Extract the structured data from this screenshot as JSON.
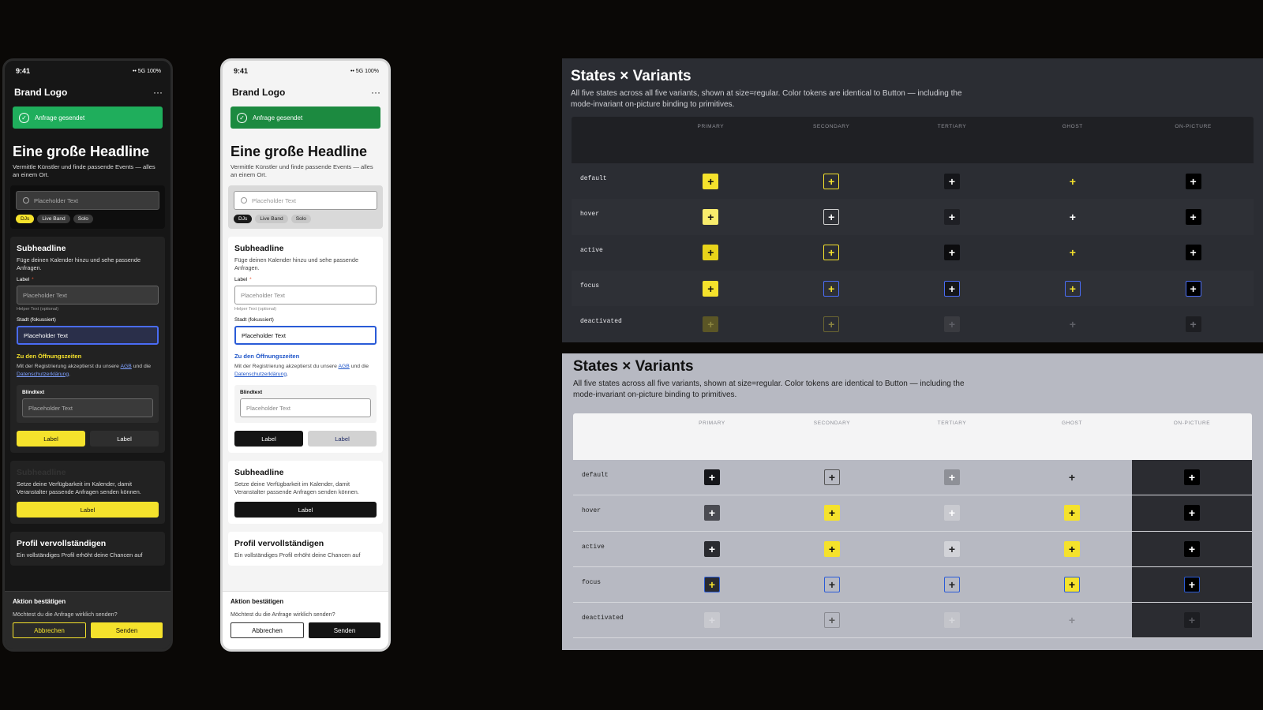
{
  "phones": [
    {
      "theme": "dark",
      "status": {
        "time": "9:41",
        "right": "•• 5G 100%"
      },
      "brand": "Brand Logo",
      "more": "···",
      "toast": "Anfrage gesendet",
      "headline": "Eine große Headline",
      "lead": "Vermittle Künstler und finde passende Events — alles an einem Ort.",
      "search_placeholder": "Placeholder Text",
      "chips": [
        "DJs",
        "Live Band",
        "Solo"
      ],
      "card1": {
        "title": "Subheadline",
        "text": "Füge deinen Kalender hinzu und sehe passende Anfragen.",
        "label": "Label",
        "req": "*",
        "field_placeholder": "Placeholder Text",
        "helper": "Helper Text (optional)",
        "focus_label": "Stadt (fokussiert)",
        "focus_value": "Placeholder Text",
        "link": "Zu den Öffnungszeiten",
        "legal_pre": "Mit der Registrierung akzeptierst du unsere",
        "legal_agb": "AGB",
        "legal_mid": "und die",
        "legal_ds": "Datenschutzerklärung",
        "legal_end": ".",
        "inner_label": "Blindtext",
        "inner_placeholder": "Placeholder Text",
        "btn_primary": "Label",
        "btn_secondary": "Label"
      },
      "card2": {
        "title": "Subheadline",
        "text": "Setze deine Verfügbarkeit im Kalender, damit Veranstalter passende Anfragen senden können.",
        "button": "Label"
      },
      "card3": {
        "title": "Profil vervollständigen",
        "text": "Ein vollständiges Profil erhöht deine Chancen auf"
      },
      "sheet": {
        "title": "Aktion bestätigen",
        "question": "Möchtest du die Anfrage wirklich senden?",
        "cancel": "Abbrechen",
        "send": "Senden"
      }
    },
    {
      "theme": "light",
      "status": {
        "time": "9:41",
        "right": "•• 5G 100%"
      },
      "brand": "Brand Logo",
      "more": "···",
      "toast": "Anfrage gesendet",
      "headline": "Eine große Headline",
      "lead": "Vermittle Künstler und finde passende Events — alles an einem Ort.",
      "search_placeholder": "Placeholder Text",
      "chips": [
        "DJs",
        "Live Band",
        "Solo"
      ],
      "card1": {
        "title": "Subheadline",
        "text": "Füge deinen Kalender hinzu und sehe passende Anfragen.",
        "label": "Label",
        "req": "*",
        "field_placeholder": "Placeholder Text",
        "helper": "Helper Text (optional)",
        "focus_label": "Stadt (fokussiert)",
        "focus_value": "Placeholder Text",
        "link": "Zu den Öffnungszeiten",
        "legal_pre": "Mit der Registrierung akzeptierst du unsere",
        "legal_agb": "AGB",
        "legal_mid": "und die",
        "legal_ds": "Datenschutzerklärung",
        "legal_end": ".",
        "inner_label": "Blindtext",
        "inner_placeholder": "Placeholder Text",
        "btn_primary": "Label",
        "btn_secondary": "Label"
      },
      "card2": {
        "title": "Subheadline",
        "text": "Setze deine Verfügbarkeit im Kalender, damit Veranstalter passende Anfragen senden können.",
        "button": "Label"
      },
      "card3": {
        "title": "Profil vervollständigen",
        "text": "Ein vollständiges Profil erhöht deine Chancen auf"
      },
      "sheet": {
        "title": "Aktion bestätigen",
        "question": "Möchtest du die Anfrage wirklich senden?",
        "cancel": "Abbrechen",
        "send": "Senden"
      }
    }
  ],
  "panels": [
    {
      "mode": "dark",
      "title": "States × Variants",
      "description": "All five states across all five variants, shown at size=regular. Color tokens are identical to Button — including the mode-invariant on-picture binding to primitives.",
      "columns": [
        "PRIMARY",
        "SECONDARY",
        "TERTIARY",
        "GHOST",
        "ON-PICTURE"
      ],
      "rows": [
        {
          "state": "default",
          "cells": [
            {
              "bg": "#f5e22c",
              "fg": "#111111",
              "border": "none"
            },
            {
              "bg": "transparent",
              "fg": "#f5e22c",
              "border": "#f5e22c"
            },
            {
              "bg": "#15161a",
              "fg": "#ffffff",
              "border": "none"
            },
            {
              "bg": "transparent",
              "fg": "#f5e22c",
              "border": "none"
            },
            {
              "bg": "#000000",
              "fg": "#ffffff",
              "border": "none"
            }
          ]
        },
        {
          "state": "hover",
          "cells": [
            {
              "bg": "#f8ec6c",
              "fg": "#111111",
              "border": "none"
            },
            {
              "bg": "transparent",
              "fg": "#ffffff",
              "border": "#cfcfcf"
            },
            {
              "bg": "#1e1f24",
              "fg": "#ffffff",
              "border": "none"
            },
            {
              "bg": "transparent",
              "fg": "#ffffff",
              "border": "none"
            },
            {
              "bg": "#000000",
              "fg": "#ffffff",
              "border": "none"
            }
          ]
        },
        {
          "state": "active",
          "cells": [
            {
              "bg": "#e8d31a",
              "fg": "#111111",
              "border": "none"
            },
            {
              "bg": "transparent",
              "fg": "#f5e22c",
              "border": "#f5e22c"
            },
            {
              "bg": "#0c0c0e",
              "fg": "#ffffff",
              "border": "none"
            },
            {
              "bg": "transparent",
              "fg": "#f5e22c",
              "border": "none"
            },
            {
              "bg": "#000000",
              "fg": "#ffffff",
              "border": "none"
            }
          ]
        },
        {
          "state": "focus",
          "cells": [
            {
              "bg": "#f5e22c",
              "fg": "#111111",
              "border": "none"
            },
            {
              "bg": "transparent",
              "fg": "#f5e22c",
              "border": "#4a6cf5"
            },
            {
              "bg": "#15161a",
              "fg": "#ffffff",
              "border": "#4a6cf5"
            },
            {
              "bg": "transparent",
              "fg": "#f5e22c",
              "border": "#4a6cf5"
            },
            {
              "bg": "#000000",
              "fg": "#ffffff",
              "border": "#4a6cf5"
            }
          ]
        },
        {
          "state": "deactivated",
          "cells": [
            {
              "bg": "#5b5626",
              "fg": "#8c8640",
              "border": "none"
            },
            {
              "bg": "transparent",
              "fg": "#8c8640",
              "border": "#6a6532"
            },
            {
              "bg": "#3a3b40",
              "fg": "#5e5f66",
              "border": "none"
            },
            {
              "bg": "transparent",
              "fg": "#5e5f66",
              "border": "none"
            },
            {
              "bg": "#1d1e22",
              "fg": "#6a6b72",
              "border": "none"
            }
          ]
        }
      ]
    },
    {
      "mode": "light",
      "title": "States × Variants",
      "description": "All five states across all five variants, shown at size=regular. Color tokens are identical to Button — including the mode-invariant on-picture binding to primitives.",
      "columns": [
        "PRIMARY",
        "SECONDARY",
        "TERTIARY",
        "GHOST",
        "ON-PICTURE"
      ],
      "rows": [
        {
          "state": "default",
          "cells": [
            {
              "bg": "#15161a",
              "fg": "#ffffff",
              "border": "none"
            },
            {
              "bg": "transparent",
              "fg": "#222222",
              "border": "#555555"
            },
            {
              "bg": "#8e9097",
              "fg": "#ffffff",
              "border": "none"
            },
            {
              "bg": "transparent",
              "fg": "#222222",
              "border": "none"
            },
            {
              "bg": "#000000",
              "fg": "#ffffff",
              "border": "none"
            }
          ]
        },
        {
          "state": "hover",
          "cells": [
            {
              "bg": "#4a4b52",
              "fg": "#ffffff",
              "border": "none"
            },
            {
              "bg": "#f5e22c",
              "fg": "#111111",
              "border": "none"
            },
            {
              "bg": "#c9cad0",
              "fg": "#ffffff",
              "border": "none"
            },
            {
              "bg": "#f5e22c",
              "fg": "#111111",
              "border": "none"
            },
            {
              "bg": "#000000",
              "fg": "#ffffff",
              "border": "none"
            }
          ]
        },
        {
          "state": "active",
          "cells": [
            {
              "bg": "#2a2b30",
              "fg": "#ffffff",
              "border": "none"
            },
            {
              "bg": "#f5e22c",
              "fg": "#111111",
              "border": "none"
            },
            {
              "bg": "#d2d3d8",
              "fg": "#222222",
              "border": "none"
            },
            {
              "bg": "#f5e22c",
              "fg": "#111111",
              "border": "none"
            },
            {
              "bg": "#000000",
              "fg": "#ffffff",
              "border": "none"
            }
          ]
        },
        {
          "state": "focus",
          "cells": [
            {
              "bg": "#2a2b30",
              "fg": "#f5e22c",
              "border": "#2a5bd7"
            },
            {
              "bg": "transparent",
              "fg": "#222222",
              "border": "#2a5bd7"
            },
            {
              "bg": "transparent",
              "fg": "#222222",
              "border": "#2a5bd7"
            },
            {
              "bg": "#f5e22c",
              "fg": "#111111",
              "border": "#2a5bd7"
            },
            {
              "bg": "#000000",
              "fg": "#ffffff",
              "border": "#2a5bd7"
            }
          ]
        },
        {
          "state": "deactivated",
          "cells": [
            {
              "bg": "#c7c8ce",
              "fg": "#d8d9de",
              "border": "none"
            },
            {
              "bg": "transparent",
              "fg": "#555555",
              "border": "#8a8b92"
            },
            {
              "bg": "#c3c4ca",
              "fg": "#d5d6db",
              "border": "none"
            },
            {
              "bg": "transparent",
              "fg": "#8a8b92",
              "border": "none"
            },
            {
              "bg": "#1d1e22",
              "fg": "#55565c",
              "border": "none"
            }
          ]
        }
      ]
    }
  ]
}
